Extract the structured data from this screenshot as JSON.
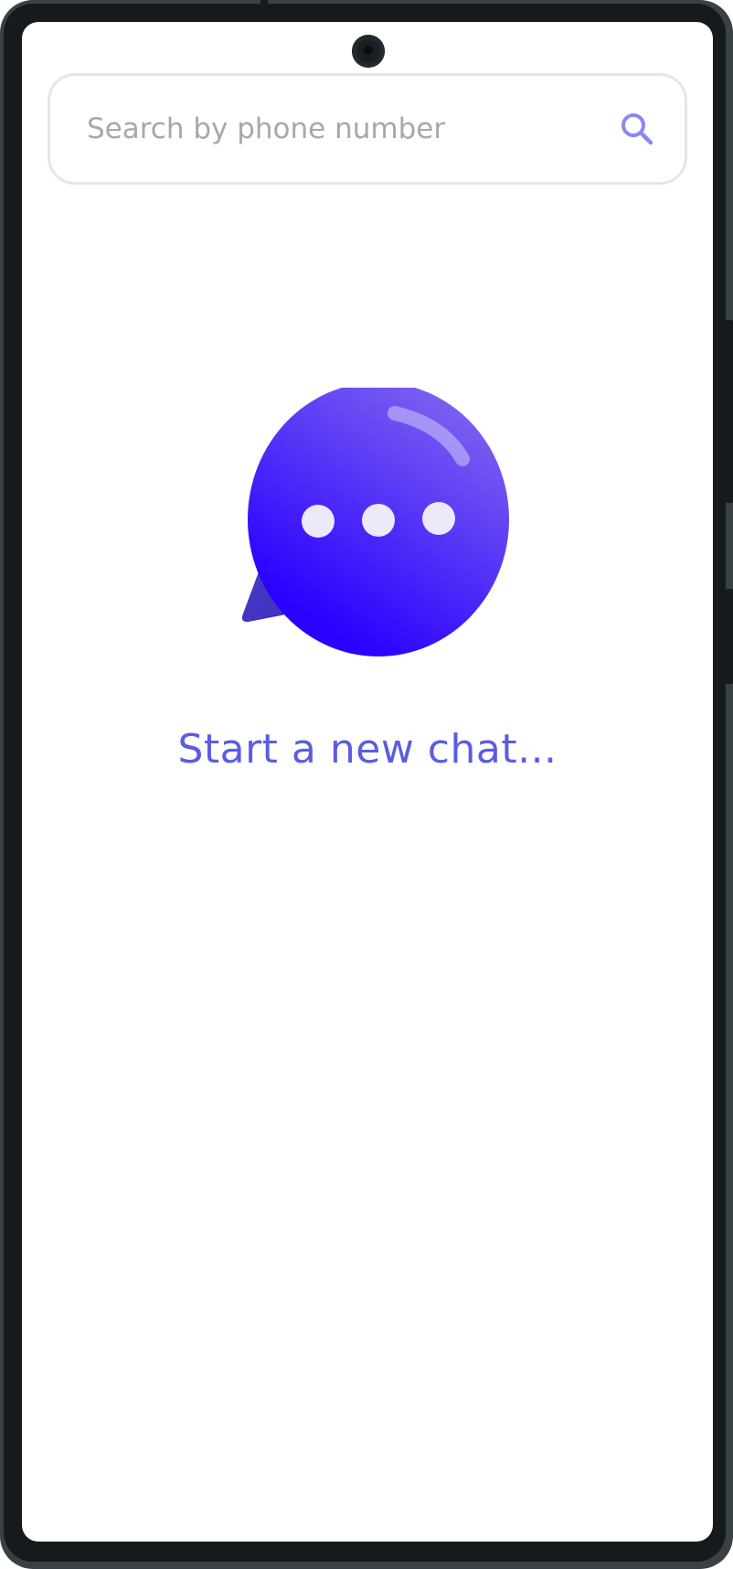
{
  "search": {
    "placeholder": "Search by phone number",
    "value": "",
    "icon": "search-icon"
  },
  "empty_state": {
    "icon": "chat-bubble-icon",
    "message": "Start a new chat..."
  },
  "colors": {
    "accent": "#5a5de0",
    "bubble_start": "#7a5ef0",
    "bubble_end": "#2a00ff",
    "search_icon": "#8a88f0",
    "border": "#e6e6ea"
  }
}
